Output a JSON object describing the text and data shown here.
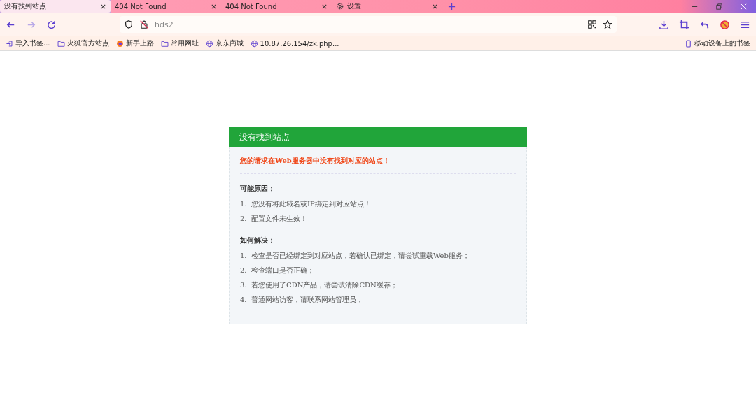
{
  "tabs": [
    {
      "label": "没有找到站点",
      "selected": true,
      "kind": "page"
    },
    {
      "label": "404 Not Found",
      "selected": false,
      "kind": "page"
    },
    {
      "label": "404 Not Found",
      "selected": false,
      "kind": "page"
    },
    {
      "label": "设置",
      "selected": false,
      "kind": "settings"
    }
  ],
  "address_bar": {
    "url": "hds2"
  },
  "bookmarks": [
    {
      "label": "导入书签...",
      "kind": "import"
    },
    {
      "label": "火狐官方站点",
      "kind": "folder"
    },
    {
      "label": "新手上路",
      "kind": "browser"
    },
    {
      "label": "常用网址",
      "kind": "folder"
    },
    {
      "label": "京东商城",
      "kind": "site"
    },
    {
      "label": "10.87.26.154/zk.php...",
      "kind": "site"
    }
  ],
  "mobile_bookmarks": "移动设备上的书签",
  "error_card": {
    "title": "没有找到站点",
    "message": "您的请求在Web服务器中没有找到对应的站点！",
    "sections": [
      {
        "heading": "可能原因：",
        "items": [
          {
            "number": "1.",
            "text": "您没有将此域名或IP绑定到对应站点！"
          },
          {
            "number": "2.",
            "text": "配置文件未生效！"
          }
        ]
      },
      {
        "heading": "如何解决：",
        "items": [
          {
            "number": "1.",
            "text": "检查是否已经绑定到对应站点，若确认已绑定，请尝试重载Web服务；"
          },
          {
            "number": "2.",
            "text": "检查端口是否正确；"
          },
          {
            "number": "3.",
            "text": "若您使用了CDN产品，请尝试清除CDN缓存；"
          },
          {
            "number": "4.",
            "text": "普通网站访客，请联系网站管理员；"
          }
        ]
      }
    ]
  }
}
